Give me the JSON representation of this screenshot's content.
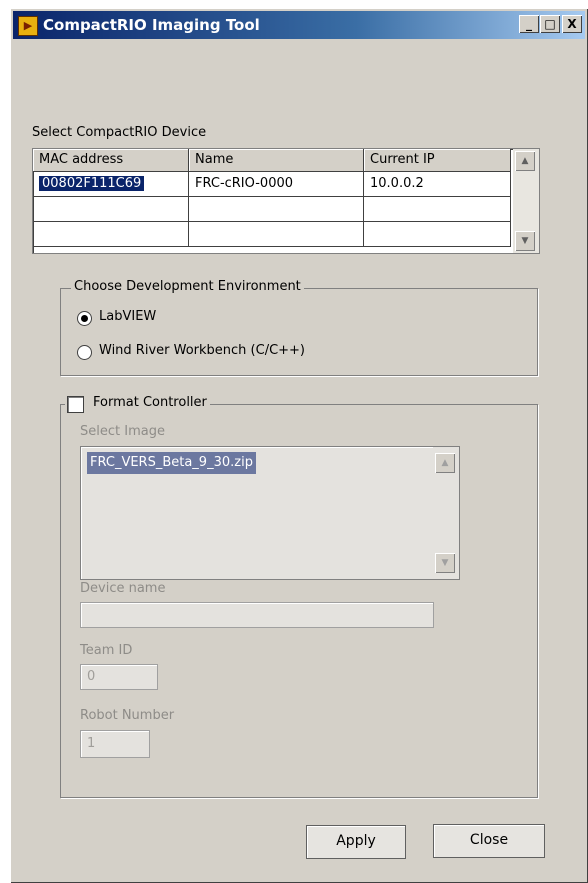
{
  "window": {
    "title": "CompactRIO Imaging Tool",
    "app_icon": "labview-app-icon",
    "controls": {
      "minimize": "_",
      "maximize": "□",
      "close": "X"
    }
  },
  "device": {
    "label": "Select CompactRIO Device",
    "columns": [
      "MAC address",
      "Name",
      "Current IP"
    ],
    "rows": [
      {
        "mac": "00802F111C69",
        "name": "FRC-cRIO-0000",
        "ip": "10.0.0.2",
        "selected": true
      }
    ],
    "scroll_up": "▲",
    "scroll_down": "▼"
  },
  "environment": {
    "title": "Choose Development Environment",
    "options": [
      {
        "label": "LabVIEW",
        "selected": true
      },
      {
        "label": "Wind River Workbench (C/C++)",
        "selected": false
      }
    ]
  },
  "format": {
    "checkbox_label": "Format Controller",
    "checked": false,
    "select_image_label": "Select Image",
    "images": [
      "FRC_VERS_Beta_9_30.zip"
    ],
    "device_name_label": "Device name",
    "device_name_value": "",
    "team_id_label": "Team ID",
    "team_id_value": "0",
    "robot_number_label": "Robot Number",
    "robot_number_value": "1"
  },
  "buttons": {
    "apply": "Apply",
    "close": "Close"
  },
  "colors": {
    "titlebar": "#0a246a",
    "selection": "#0a246a",
    "face": "#d4d0c8"
  }
}
